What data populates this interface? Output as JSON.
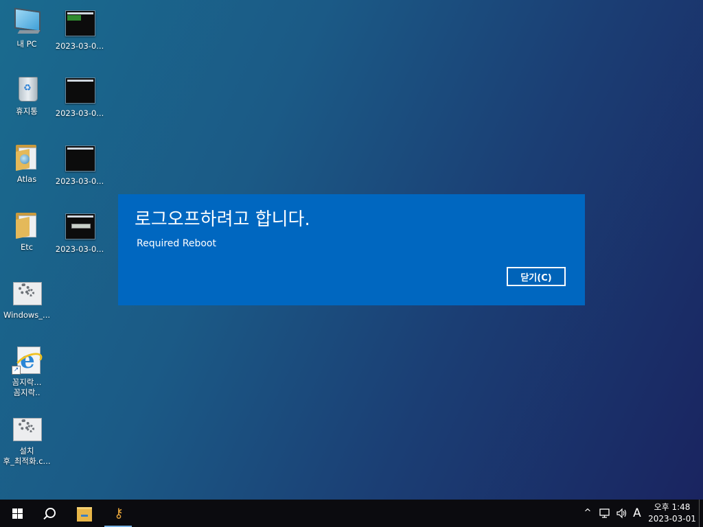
{
  "desktop": {
    "icons": [
      {
        "label": "내 PC"
      },
      {
        "label": "2023-03-0..."
      },
      {
        "label": "휴지통"
      },
      {
        "label": "2023-03-0..."
      },
      {
        "label": "Atlas"
      },
      {
        "label": "2023-03-0..."
      },
      {
        "label": "Etc"
      },
      {
        "label": "2023-03-0..."
      },
      {
        "label": "Windows_..."
      },
      {
        "label": "꼼지락...",
        "label2": "꼼지락.."
      },
      {
        "label": "설치",
        "label2": "후_최적화.c..."
      }
    ]
  },
  "dialog": {
    "title": "로그오프하려고 합니다.",
    "message": "Required Reboot",
    "close_label": "닫기(C)",
    "background_color": "#0067c0"
  },
  "taskbar": {
    "start_icon": "windows-logo-icon",
    "search_icon": "search-icon",
    "pinned": [
      {
        "name": "file-explorer-icon"
      },
      {
        "name": "keys-app-icon",
        "active": true
      }
    ],
    "tray": {
      "chevron": "^",
      "network_icon": "network-icon",
      "volume_icon": "volume-icon",
      "ime_indicator": "A",
      "time": "오후 1:48",
      "date": "2023-03-01"
    }
  }
}
